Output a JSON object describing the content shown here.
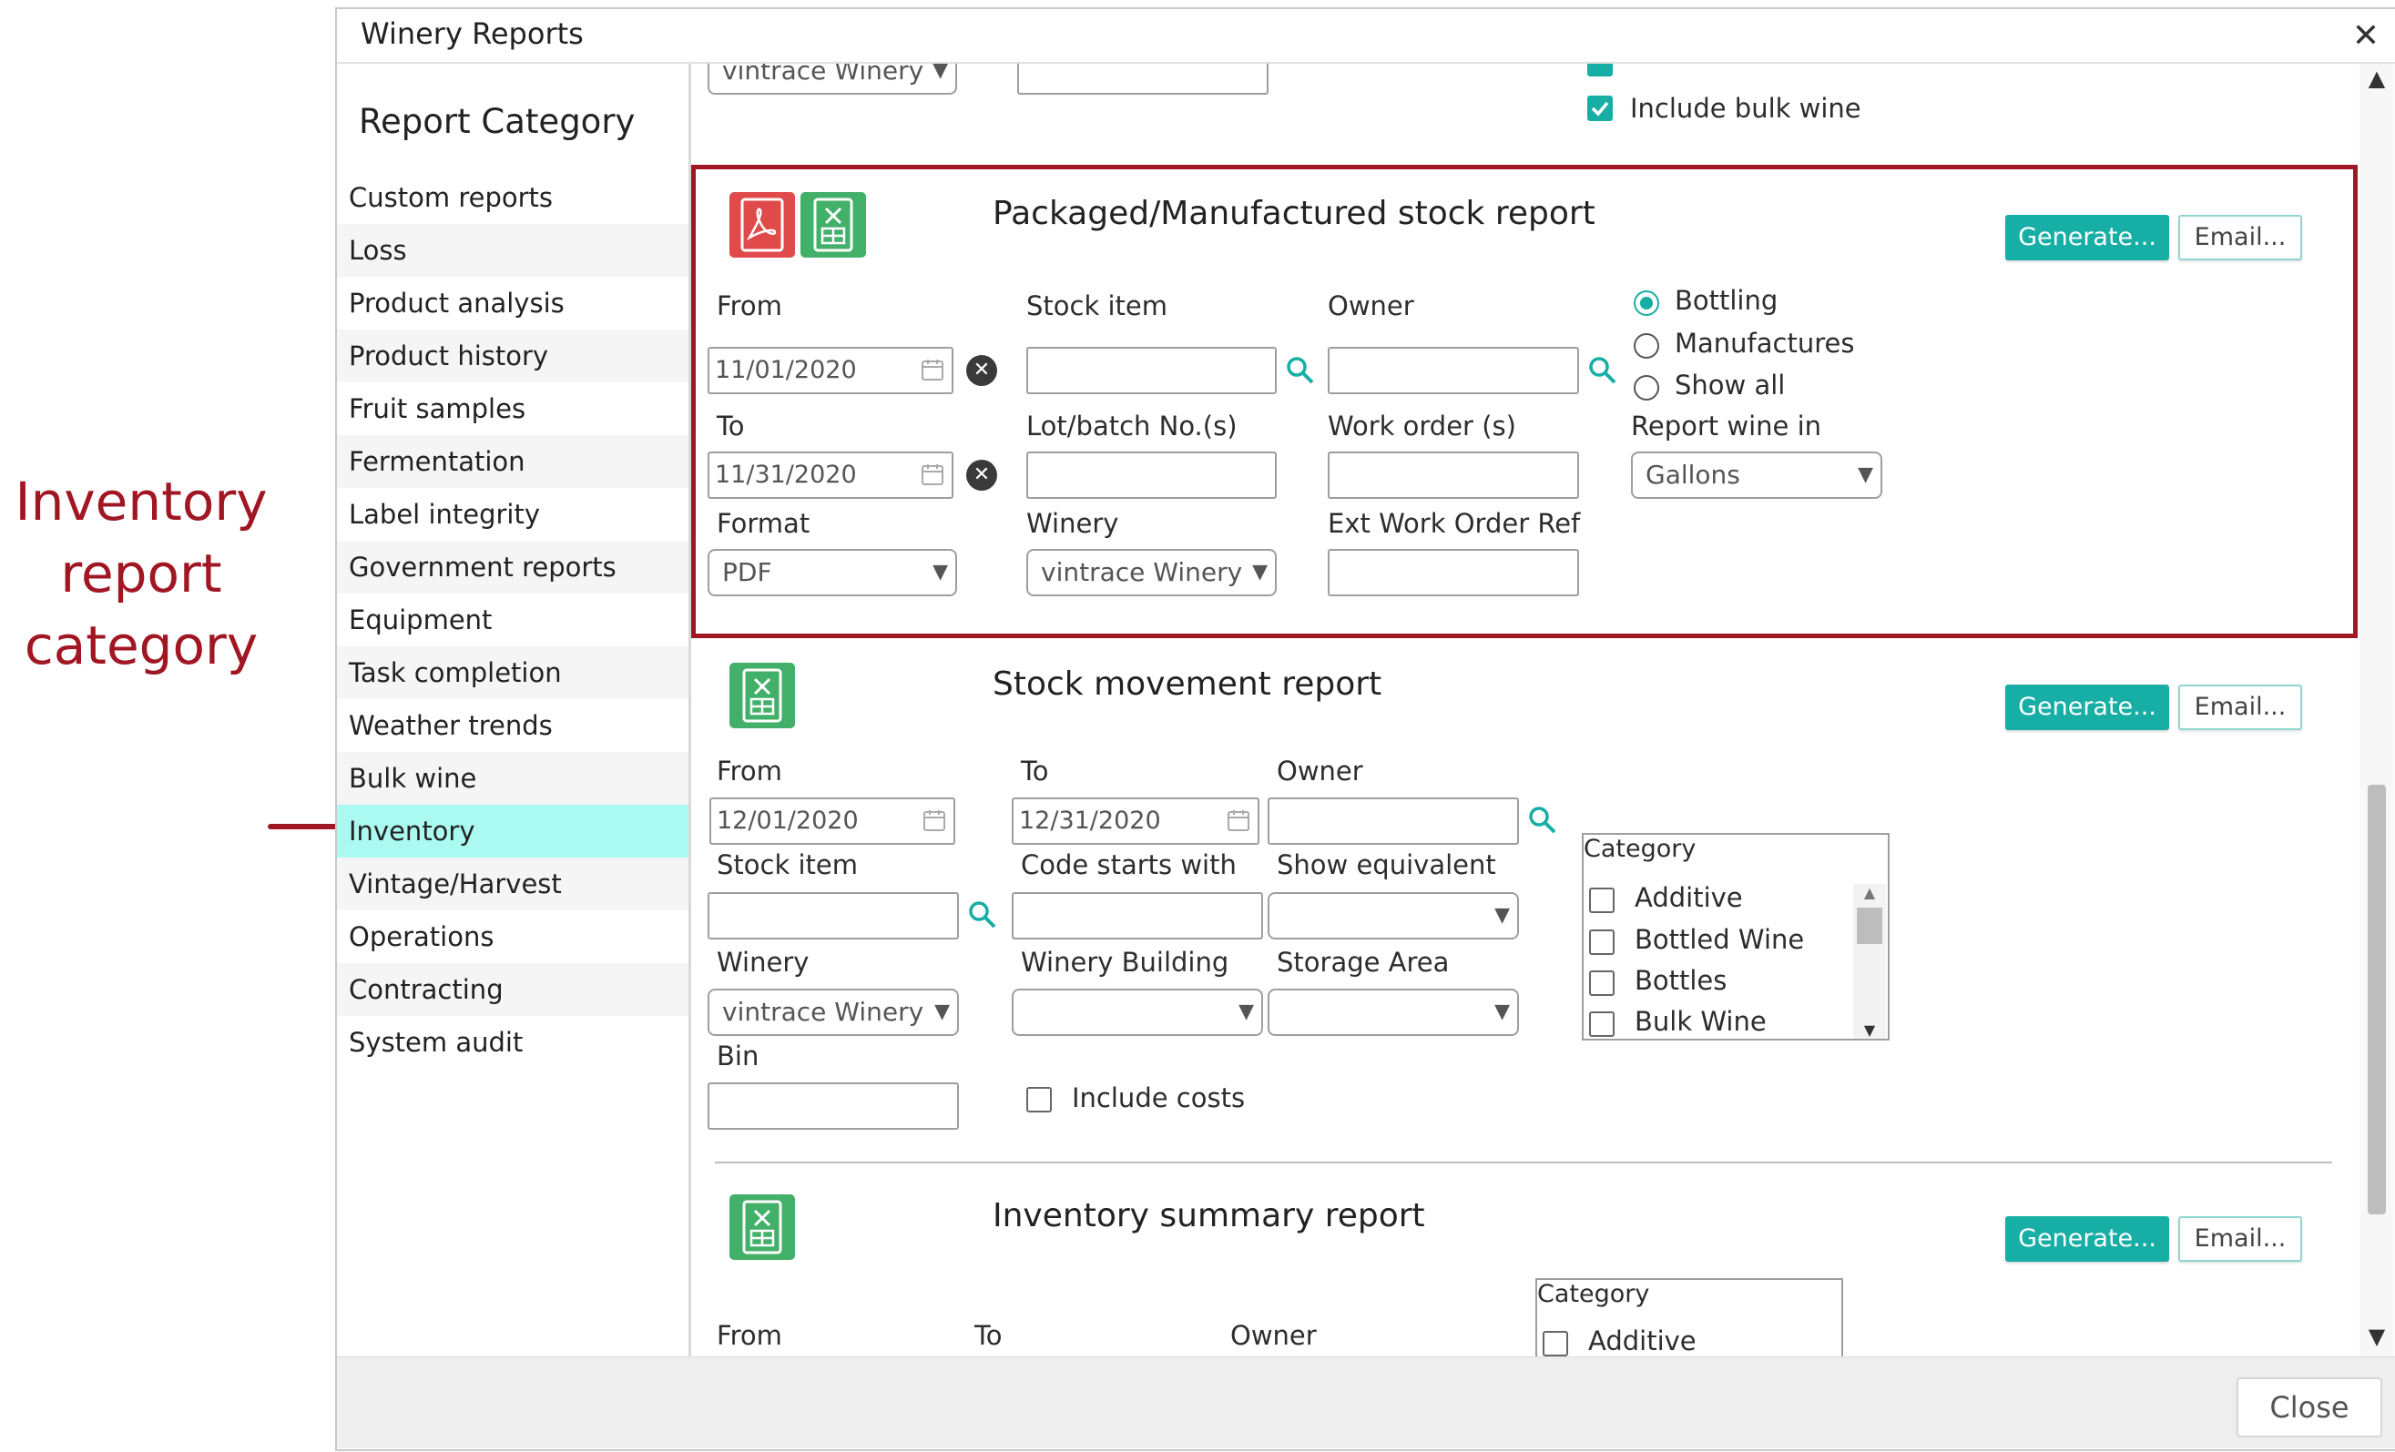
{
  "annotation": {
    "line1": "Inventory",
    "line2": "report",
    "line3": "category"
  },
  "dialog": {
    "title": "Winery Reports",
    "close_label": "Close"
  },
  "sidebar": {
    "title": "Report Category",
    "items": [
      {
        "label": "Custom reports"
      },
      {
        "label": "Loss"
      },
      {
        "label": "Product analysis"
      },
      {
        "label": "Product history"
      },
      {
        "label": "Fruit samples"
      },
      {
        "label": "Fermentation"
      },
      {
        "label": "Label integrity"
      },
      {
        "label": "Government reports"
      },
      {
        "label": "Equipment"
      },
      {
        "label": "Task completion"
      },
      {
        "label": "Weather trends"
      },
      {
        "label": "Bulk wine"
      },
      {
        "label": "Inventory",
        "selected": true
      },
      {
        "label": "Vintage/Harvest"
      },
      {
        "label": "Operations"
      },
      {
        "label": "Contracting"
      },
      {
        "label": "System audit"
      }
    ]
  },
  "top_partial": {
    "winery_value": "vintrace Winery",
    "include_bulk_label": "Include bulk wine",
    "include_bulk_checked": true
  },
  "packaged_report": {
    "title": "Packaged/Manufactured stock report",
    "generate_label": "Generate...",
    "email_label": "Email...",
    "from_label": "From",
    "from_value": "11/01/2020",
    "to_label": "To",
    "to_value": "11/31/2020",
    "format_label": "Format",
    "format_value": "PDF",
    "stock_item_label": "Stock item",
    "lot_label": "Lot/batch No.(s)",
    "winery_label": "Winery",
    "winery_value": "vintrace Winery",
    "owner_label": "Owner",
    "work_order_label": "Work order (s)",
    "ext_ref_label": "Ext Work Order Ref",
    "radio_options": [
      {
        "label": "Bottling",
        "checked": true
      },
      {
        "label": "Manufactures",
        "checked": false
      },
      {
        "label": "Show all",
        "checked": false
      }
    ],
    "report_wine_label": "Report wine in",
    "report_wine_value": "Gallons"
  },
  "stock_movement_report": {
    "title": "Stock movement report",
    "generate_label": "Generate...",
    "email_label": "Email...",
    "from_label": "From",
    "from_value": "12/01/2020",
    "to_label": "To",
    "to_value": "12/31/2020",
    "owner_label": "Owner",
    "stock_item_label": "Stock item",
    "code_label": "Code starts with",
    "show_equiv_label": "Show equivalent",
    "winery_label": "Winery",
    "winery_value": "vintrace Winery",
    "building_label": "Winery Building",
    "storage_label": "Storage Area",
    "bin_label": "Bin",
    "include_costs_label": "Include costs",
    "category_label": "Category",
    "categories": [
      "Additive",
      "Bottled Wine",
      "Bottles",
      "Bulk Wine"
    ]
  },
  "inventory_summary_report": {
    "title": "Inventory summary report",
    "generate_label": "Generate...",
    "email_label": "Email...",
    "from_label": "From",
    "to_label": "To",
    "owner_label": "Owner",
    "category_label": "Category",
    "first_category": "Additive"
  },
  "colors": {
    "accent": "#17aea6",
    "annotation": "#a01622",
    "selected_bg": "#aafaf2"
  },
  "icons": [
    "pdf-icon",
    "excel-icon",
    "calendar-icon",
    "clear-icon",
    "search-icon",
    "close-icon"
  ]
}
